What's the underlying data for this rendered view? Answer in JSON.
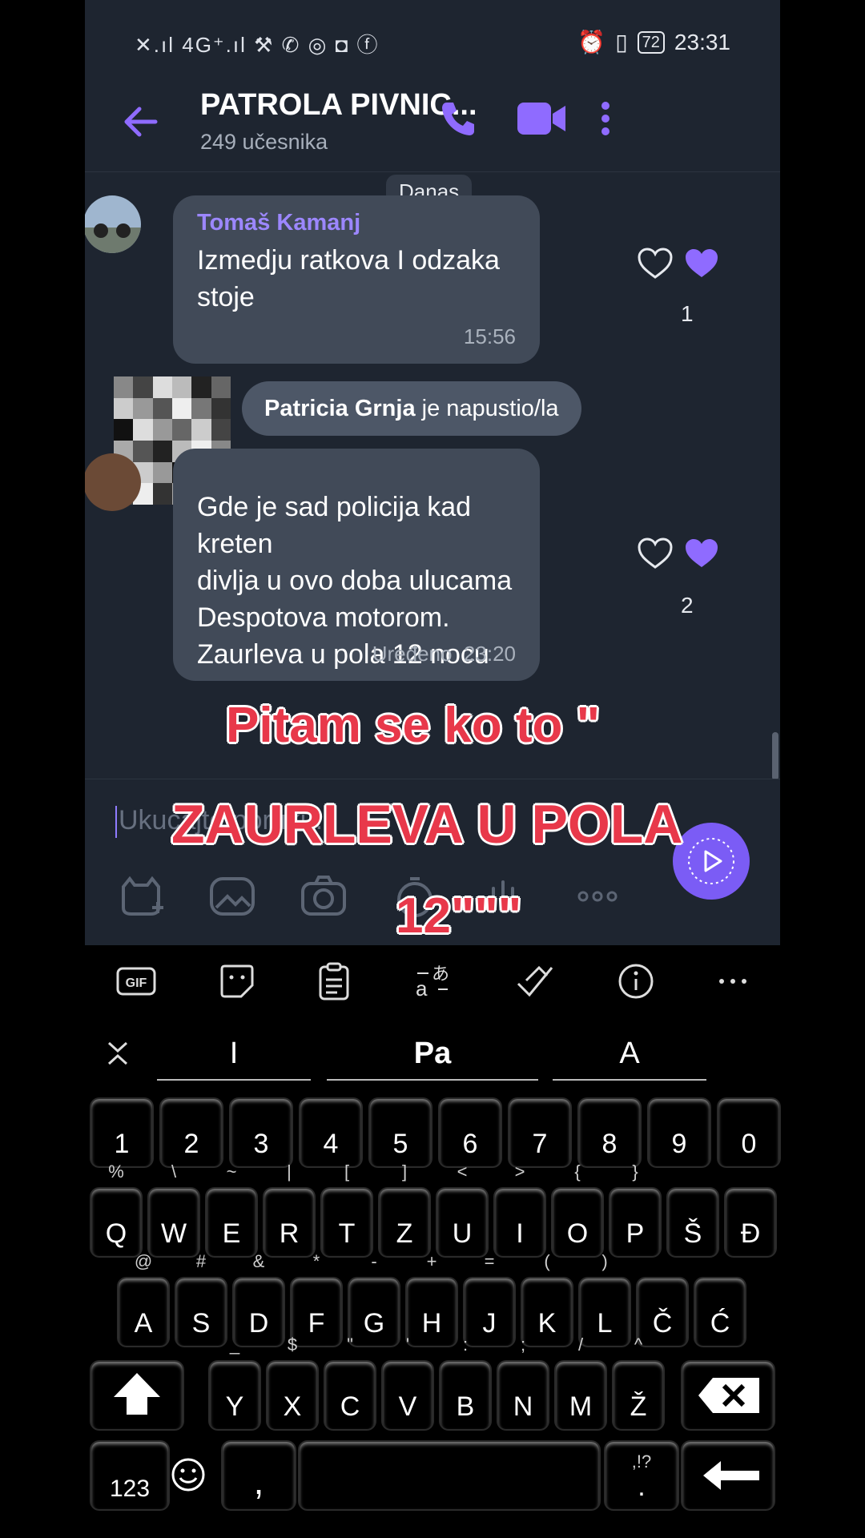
{
  "status_bar": {
    "left_icons": "4G⁺",
    "battery": "72",
    "time": "23:31"
  },
  "header": {
    "title": "PATROLA PIVNIC...",
    "subtitle": "249 učesnika"
  },
  "chat": {
    "date_chip": "Danas",
    "messages": [
      {
        "sender": "Tomaš Kamanj",
        "lines": [
          "Izmedju ratkova I odzaka",
          "stoje"
        ],
        "time": "15:56",
        "reaction_count": "1"
      },
      {
        "sender": "",
        "lines": [
          "Gde je sad policija kad kreten",
          "divlja u ovo doba ulucama",
          "Despotova motorom.",
          "Zaurleva  u pola 12 nocu"
        ],
        "edited": "Uređeno",
        "time": "23:20",
        "reaction_count": "2"
      }
    ],
    "system_notice": {
      "name": "Patricia Grnja",
      "text": " je napustio/la"
    }
  },
  "composer": {
    "placeholder": "Ukucajte poruku..."
  },
  "overlay_text": {
    "line1": "Pitam se ko to \"",
    "line2": "ZAURLEVA U POLA",
    "line3": "12\"\"\""
  },
  "keyboard": {
    "suggestions": [
      "I",
      "Pa",
      "A"
    ],
    "numbers": [
      "1",
      "2",
      "3",
      "4",
      "5",
      "6",
      "7",
      "8",
      "9",
      "0"
    ],
    "row1": [
      "Q",
      "W",
      "E",
      "R",
      "T",
      "Z",
      "U",
      "I",
      "O",
      "P",
      "Š",
      "Đ"
    ],
    "row1_alt": [
      "%",
      "\\",
      "~",
      "|",
      "[",
      "]",
      "<",
      ">",
      "{",
      "}",
      "",
      ""
    ],
    "row2": [
      "A",
      "S",
      "D",
      "F",
      "G",
      "H",
      "J",
      "K",
      "L",
      "Č",
      "Ć"
    ],
    "row2_alt": [
      "@",
      "#",
      "&",
      "*",
      "-",
      "+",
      "=",
      "(",
      ")",
      "",
      ""
    ],
    "row3": [
      "Y",
      "X",
      "C",
      "V",
      "B",
      "N",
      "M",
      "Ž"
    ],
    "row3_alt": [
      "_",
      "$",
      "\"",
      "'",
      ":",
      ";",
      "/",
      "^"
    ],
    "num_key": "123",
    "comma": ",",
    "period": ".",
    "period_alt": ",!?"
  },
  "colors": {
    "accent": "#8f6bff",
    "bubble": "#414a58",
    "background": "#1e2530",
    "overlay_red": "#e8384a"
  }
}
